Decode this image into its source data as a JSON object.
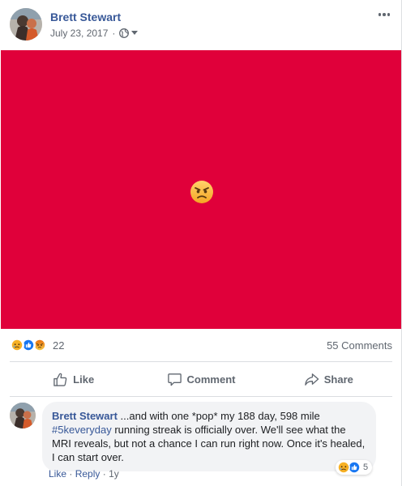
{
  "post": {
    "author": "Brett Stewart",
    "date": "July 23, 2017",
    "separator": "·",
    "privacy_icon": "globe-icon",
    "image_color": "#e0003a",
    "image_emoji": "angry-face"
  },
  "summary": {
    "reaction_icons": [
      "sad",
      "like",
      "angry"
    ],
    "reaction_count": "22",
    "comment_count": "55 Comments"
  },
  "actions": {
    "like": "Like",
    "comment": "Comment",
    "share": "Share"
  },
  "comment": {
    "author": "Brett Stewart",
    "text_part1": " ...and with one *pop* my 188 day, 598 mile ",
    "hashtag": "#5keveryday",
    "text_part2": " running streak is officially over. We'll see what the MRI reveals, but not a chance I can run right now. Once it's healed, I can start over.",
    "reaction_count": "5",
    "like_link": "Like",
    "reply_link": "Reply",
    "time": "1y",
    "separator": "·"
  },
  "colors": {
    "link_blue": "#385898",
    "like_blue": "#1877f2",
    "sad_yellow": "#f7b125",
    "angry_orange": "#e9710f"
  }
}
